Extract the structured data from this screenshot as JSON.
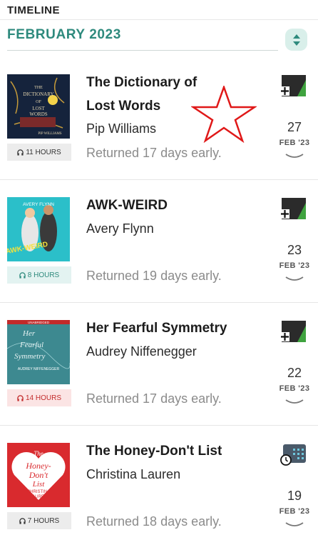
{
  "header": {
    "title": "TIMELINE"
  },
  "section": {
    "month_label": "FEBRUARY 2023"
  },
  "items": [
    {
      "title_line1": "The Dictionary of",
      "title_line2": "Lost Words",
      "author": "Pip Williams",
      "note": "Returned 17 days early.",
      "duration": "11 HOURS",
      "day": "27",
      "month_year": "FEB '23",
      "cover": {
        "text1": "THE",
        "text2": "DICTIONARY",
        "text3": "OF",
        "text4": "LOST",
        "text5": "WORDS",
        "text6": "PIP WILLIAMS"
      }
    },
    {
      "title_line1": "AWK-WEIRD",
      "author": "Avery Flynn",
      "note": "Returned 19 days early.",
      "duration": "8 HOURS",
      "day": "23",
      "month_year": "FEB '23",
      "cover": {
        "text1": "AVERY FLYNN",
        "text2": "AWK-WEIRD"
      }
    },
    {
      "title_line1": "Her Fearful Symmetry",
      "author": "Audrey Niffenegger",
      "note": "Returned 17 days early.",
      "duration": "14 HOURS",
      "day": "22",
      "month_year": "FEB '23",
      "cover": {
        "text1": "UNABRIDGED",
        "text2": "Her",
        "text3": "Fearful",
        "text4": "Symmetry",
        "text5": "AUDREY NIFFENEGGER"
      }
    },
    {
      "title_line1": "The Honey-Don't List",
      "author": "Christina Lauren",
      "note": "Returned 18 days early.",
      "duration": "7 HOURS",
      "day": "19",
      "month_year": "FEB '23",
      "cover": {
        "text1": "The",
        "text2": "Honey-",
        "text3": "Don't",
        "text4": "List",
        "text5": "CHRISTINA",
        "text6": "LAUREN"
      }
    }
  ],
  "colors": {
    "accent": "#2e8a7d",
    "sort_bg": "#d9efea",
    "status_green": "#3fa33f",
    "status_dark": "#2b2b2b",
    "annotation_star": "#e01818"
  },
  "icons": {
    "sort": "sort-updown-icon",
    "status_added": "plus-tag-icon",
    "status_calendar": "calendar-clock-icon",
    "duration": "headphones-icon",
    "expand": "chevron-down-icon"
  }
}
